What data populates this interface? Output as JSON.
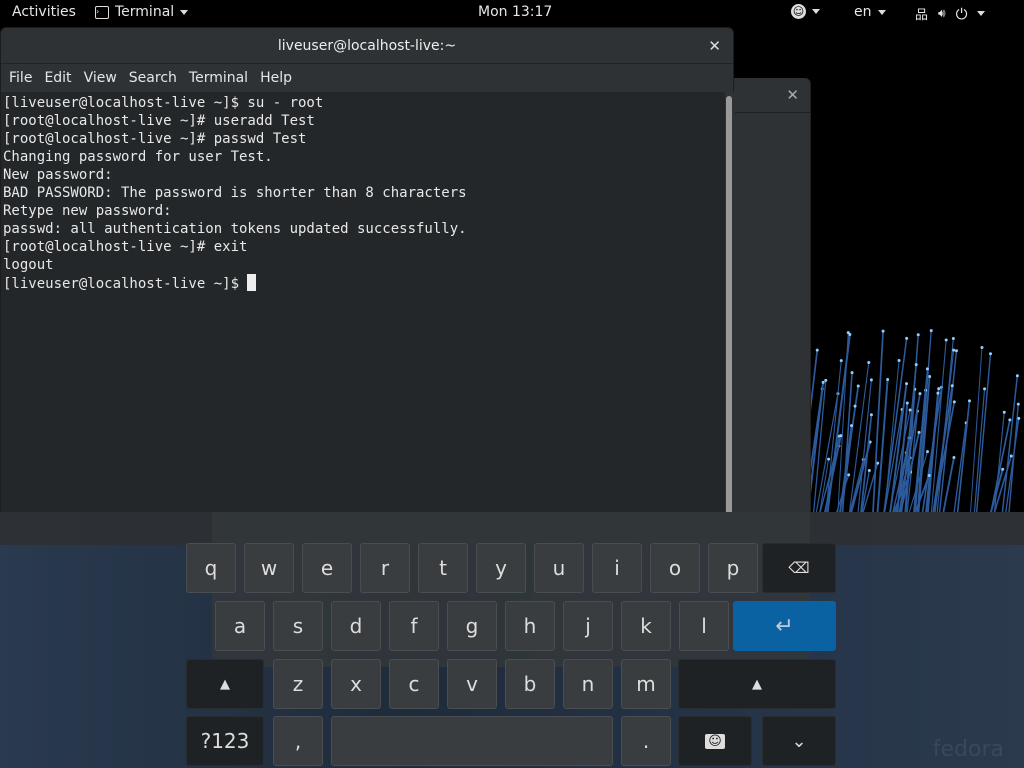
{
  "topbar": {
    "activities": "Activities",
    "app": "Terminal",
    "clock": "Mon 13:17",
    "lang": "en",
    "icons": [
      "accessibility-icon",
      "network-icon",
      "volume-icon",
      "power-icon"
    ]
  },
  "terminal": {
    "title": "liveuser@localhost-live:~",
    "menu": [
      "File",
      "Edit",
      "View",
      "Search",
      "Terminal",
      "Help"
    ],
    "lines": [
      "[liveuser@localhost-live ~]$ su - root",
      "[root@localhost-live ~]# useradd Test",
      "[root@localhost-live ~]# passwd Test",
      "Changing password for user Test.",
      "New password:",
      "BAD PASSWORD: The password is shorter than 8 characters",
      "Retype new password:",
      "passwd: all authentication tokens updated successfully.",
      "[root@localhost-live ~]# exit",
      "logout",
      "[liveuser@localhost-live ~]$ "
    ]
  },
  "keyboard": {
    "row1": [
      "q",
      "w",
      "e",
      "r",
      "t",
      "y",
      "u",
      "i",
      "o",
      "p"
    ],
    "row2": [
      "a",
      "s",
      "d",
      "f",
      "g",
      "h",
      "j",
      "k",
      "l"
    ],
    "row3": [
      "z",
      "x",
      "c",
      "v",
      "b",
      "n",
      "m"
    ],
    "numbers_label": "?123",
    "comma": ",",
    "period": ".",
    "colors": {
      "enter": "#0b62a3",
      "key": "#393d3f",
      "special": "#1f2224"
    }
  },
  "watermark": "fedora"
}
